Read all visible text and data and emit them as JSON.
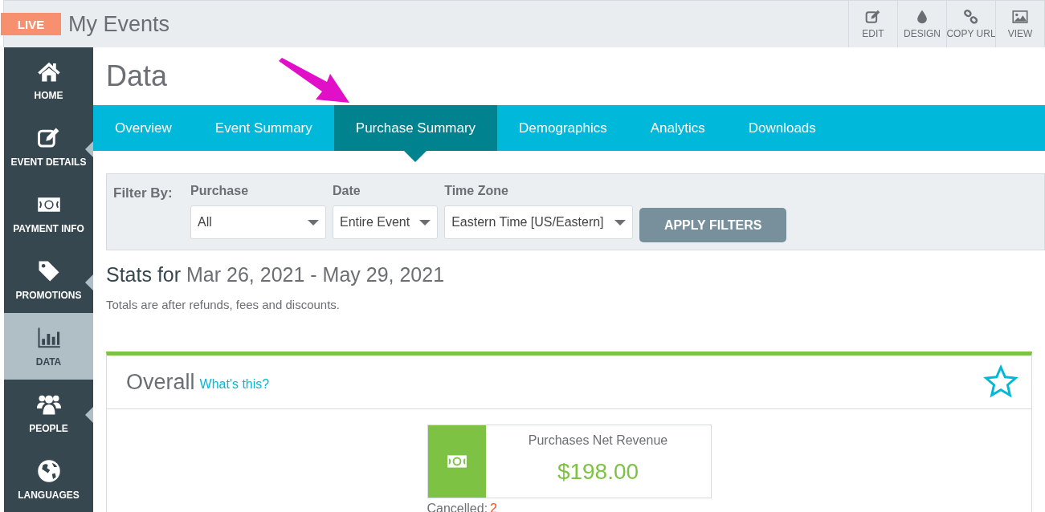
{
  "header": {
    "badge": "LIVE",
    "title": "My Events",
    "actions": [
      {
        "kind": "edit",
        "label": "EDIT"
      },
      {
        "kind": "drop",
        "label": "DESIGN"
      },
      {
        "kind": "link",
        "label": "COPY URL"
      },
      {
        "kind": "image",
        "label": "VIEW"
      }
    ]
  },
  "sidebar": {
    "items": [
      {
        "kind": "home",
        "label": "HOME",
        "selected": false,
        "has_submenu": false
      },
      {
        "kind": "edit",
        "label": "EVENT DETAILS",
        "selected": false,
        "has_submenu": true
      },
      {
        "kind": "money",
        "label": "PAYMENT INFO",
        "selected": false,
        "has_submenu": false
      },
      {
        "kind": "tag",
        "label": "PROMOTIONS",
        "selected": false,
        "has_submenu": true
      },
      {
        "kind": "chart",
        "label": "DATA",
        "selected": true,
        "has_submenu": false
      },
      {
        "kind": "people",
        "label": "PEOPLE",
        "selected": false,
        "has_submenu": true
      },
      {
        "kind": "globe",
        "label": "LANGUAGES",
        "selected": false,
        "has_submenu": false
      }
    ]
  },
  "page_title": "Data",
  "tabs": [
    {
      "label": "Overview",
      "selected": false
    },
    {
      "label": "Event Summary",
      "selected": false
    },
    {
      "label": "Purchase Summary",
      "selected": true
    },
    {
      "label": "Demographics",
      "selected": false
    },
    {
      "label": "Analytics",
      "selected": false
    },
    {
      "label": "Downloads",
      "selected": false
    }
  ],
  "filters": {
    "label": "Filter By:",
    "fields": [
      {
        "label": "Purchase",
        "value": "All"
      },
      {
        "label": "Date",
        "value": "Entire Event"
      },
      {
        "label": "Time Zone",
        "value": "Eastern Time [US/Eastern]"
      }
    ],
    "button": "APPLY FILTERS"
  },
  "stats": {
    "prefix": "Stats for",
    "range": "Mar 26, 2021 - May 29, 2021",
    "note": "Totals are after refunds, fees and discounts."
  },
  "overall": {
    "title": "Overall",
    "help_link": "What's this?",
    "favorite": false,
    "metric": {
      "label": "Purchases Net Revenue",
      "value": "$198.00"
    },
    "cancelled_label": "Cancelled:",
    "cancelled_value": "2"
  }
}
